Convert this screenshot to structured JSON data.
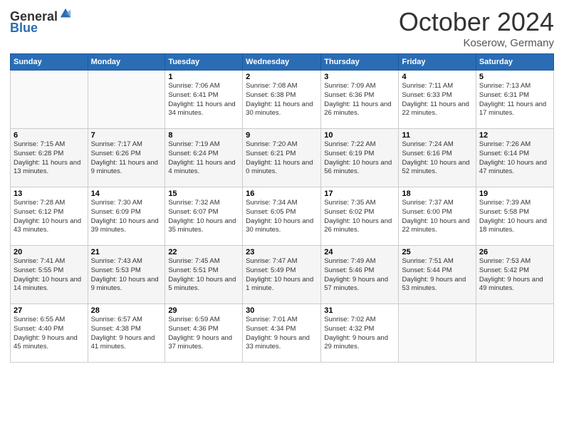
{
  "header": {
    "logo_general": "General",
    "logo_blue": "Blue",
    "month": "October 2024",
    "location": "Koserow, Germany"
  },
  "weekdays": [
    "Sunday",
    "Monday",
    "Tuesday",
    "Wednesday",
    "Thursday",
    "Friday",
    "Saturday"
  ],
  "weeks": [
    [
      {
        "day": "",
        "sunrise": "",
        "sunset": "",
        "daylight": ""
      },
      {
        "day": "",
        "sunrise": "",
        "sunset": "",
        "daylight": ""
      },
      {
        "day": "1",
        "sunrise": "Sunrise: 7:06 AM",
        "sunset": "Sunset: 6:41 PM",
        "daylight": "Daylight: 11 hours and 34 minutes."
      },
      {
        "day": "2",
        "sunrise": "Sunrise: 7:08 AM",
        "sunset": "Sunset: 6:38 PM",
        "daylight": "Daylight: 11 hours and 30 minutes."
      },
      {
        "day": "3",
        "sunrise": "Sunrise: 7:09 AM",
        "sunset": "Sunset: 6:36 PM",
        "daylight": "Daylight: 11 hours and 26 minutes."
      },
      {
        "day": "4",
        "sunrise": "Sunrise: 7:11 AM",
        "sunset": "Sunset: 6:33 PM",
        "daylight": "Daylight: 11 hours and 22 minutes."
      },
      {
        "day": "5",
        "sunrise": "Sunrise: 7:13 AM",
        "sunset": "Sunset: 6:31 PM",
        "daylight": "Daylight: 11 hours and 17 minutes."
      }
    ],
    [
      {
        "day": "6",
        "sunrise": "Sunrise: 7:15 AM",
        "sunset": "Sunset: 6:28 PM",
        "daylight": "Daylight: 11 hours and 13 minutes."
      },
      {
        "day": "7",
        "sunrise": "Sunrise: 7:17 AM",
        "sunset": "Sunset: 6:26 PM",
        "daylight": "Daylight: 11 hours and 9 minutes."
      },
      {
        "day": "8",
        "sunrise": "Sunrise: 7:19 AM",
        "sunset": "Sunset: 6:24 PM",
        "daylight": "Daylight: 11 hours and 4 minutes."
      },
      {
        "day": "9",
        "sunrise": "Sunrise: 7:20 AM",
        "sunset": "Sunset: 6:21 PM",
        "daylight": "Daylight: 11 hours and 0 minutes."
      },
      {
        "day": "10",
        "sunrise": "Sunrise: 7:22 AM",
        "sunset": "Sunset: 6:19 PM",
        "daylight": "Daylight: 10 hours and 56 minutes."
      },
      {
        "day": "11",
        "sunrise": "Sunrise: 7:24 AM",
        "sunset": "Sunset: 6:16 PM",
        "daylight": "Daylight: 10 hours and 52 minutes."
      },
      {
        "day": "12",
        "sunrise": "Sunrise: 7:26 AM",
        "sunset": "Sunset: 6:14 PM",
        "daylight": "Daylight: 10 hours and 47 minutes."
      }
    ],
    [
      {
        "day": "13",
        "sunrise": "Sunrise: 7:28 AM",
        "sunset": "Sunset: 6:12 PM",
        "daylight": "Daylight: 10 hours and 43 minutes."
      },
      {
        "day": "14",
        "sunrise": "Sunrise: 7:30 AM",
        "sunset": "Sunset: 6:09 PM",
        "daylight": "Daylight: 10 hours and 39 minutes."
      },
      {
        "day": "15",
        "sunrise": "Sunrise: 7:32 AM",
        "sunset": "Sunset: 6:07 PM",
        "daylight": "Daylight: 10 hours and 35 minutes."
      },
      {
        "day": "16",
        "sunrise": "Sunrise: 7:34 AM",
        "sunset": "Sunset: 6:05 PM",
        "daylight": "Daylight: 10 hours and 30 minutes."
      },
      {
        "day": "17",
        "sunrise": "Sunrise: 7:35 AM",
        "sunset": "Sunset: 6:02 PM",
        "daylight": "Daylight: 10 hours and 26 minutes."
      },
      {
        "day": "18",
        "sunrise": "Sunrise: 7:37 AM",
        "sunset": "Sunset: 6:00 PM",
        "daylight": "Daylight: 10 hours and 22 minutes."
      },
      {
        "day": "19",
        "sunrise": "Sunrise: 7:39 AM",
        "sunset": "Sunset: 5:58 PM",
        "daylight": "Daylight: 10 hours and 18 minutes."
      }
    ],
    [
      {
        "day": "20",
        "sunrise": "Sunrise: 7:41 AM",
        "sunset": "Sunset: 5:55 PM",
        "daylight": "Daylight: 10 hours and 14 minutes."
      },
      {
        "day": "21",
        "sunrise": "Sunrise: 7:43 AM",
        "sunset": "Sunset: 5:53 PM",
        "daylight": "Daylight: 10 hours and 9 minutes."
      },
      {
        "day": "22",
        "sunrise": "Sunrise: 7:45 AM",
        "sunset": "Sunset: 5:51 PM",
        "daylight": "Daylight: 10 hours and 5 minutes."
      },
      {
        "day": "23",
        "sunrise": "Sunrise: 7:47 AM",
        "sunset": "Sunset: 5:49 PM",
        "daylight": "Daylight: 10 hours and 1 minute."
      },
      {
        "day": "24",
        "sunrise": "Sunrise: 7:49 AM",
        "sunset": "Sunset: 5:46 PM",
        "daylight": "Daylight: 9 hours and 57 minutes."
      },
      {
        "day": "25",
        "sunrise": "Sunrise: 7:51 AM",
        "sunset": "Sunset: 5:44 PM",
        "daylight": "Daylight: 9 hours and 53 minutes."
      },
      {
        "day": "26",
        "sunrise": "Sunrise: 7:53 AM",
        "sunset": "Sunset: 5:42 PM",
        "daylight": "Daylight: 9 hours and 49 minutes."
      }
    ],
    [
      {
        "day": "27",
        "sunrise": "Sunrise: 6:55 AM",
        "sunset": "Sunset: 4:40 PM",
        "daylight": "Daylight: 9 hours and 45 minutes."
      },
      {
        "day": "28",
        "sunrise": "Sunrise: 6:57 AM",
        "sunset": "Sunset: 4:38 PM",
        "daylight": "Daylight: 9 hours and 41 minutes."
      },
      {
        "day": "29",
        "sunrise": "Sunrise: 6:59 AM",
        "sunset": "Sunset: 4:36 PM",
        "daylight": "Daylight: 9 hours and 37 minutes."
      },
      {
        "day": "30",
        "sunrise": "Sunrise: 7:01 AM",
        "sunset": "Sunset: 4:34 PM",
        "daylight": "Daylight: 9 hours and 33 minutes."
      },
      {
        "day": "31",
        "sunrise": "Sunrise: 7:02 AM",
        "sunset": "Sunset: 4:32 PM",
        "daylight": "Daylight: 9 hours and 29 minutes."
      },
      {
        "day": "",
        "sunrise": "",
        "sunset": "",
        "daylight": ""
      },
      {
        "day": "",
        "sunrise": "",
        "sunset": "",
        "daylight": ""
      }
    ]
  ]
}
